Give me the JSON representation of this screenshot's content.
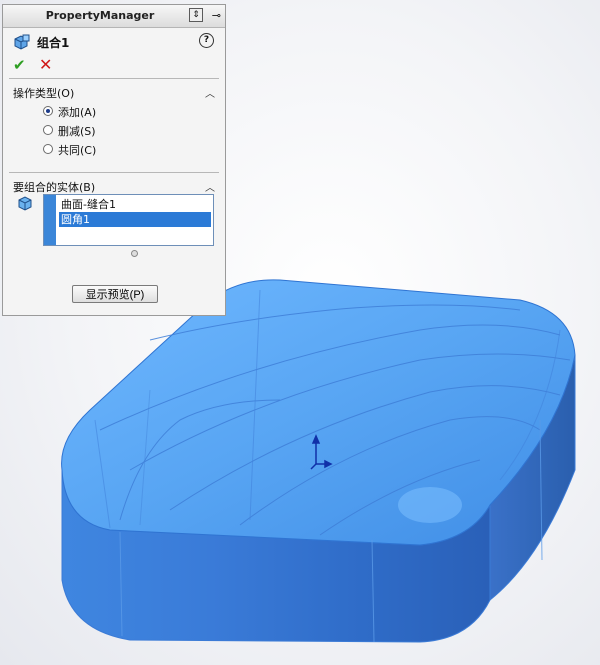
{
  "panel": {
    "title": "PropertyManager",
    "feature_name": "组合1",
    "help": "?"
  },
  "operation_type": {
    "title": "操作类型(O)",
    "options": [
      {
        "label": "添加(A)",
        "selected": true
      },
      {
        "label": "删减(S)",
        "selected": false
      },
      {
        "label": "共同(C)",
        "selected": false
      }
    ]
  },
  "bodies": {
    "title": "要组合的实体(B)",
    "items": [
      {
        "label": "曲面-缝合1",
        "selected": false
      },
      {
        "label": "圆角1",
        "selected": true
      }
    ]
  },
  "preview_button": "显示预览(P)",
  "colors": {
    "model_top": "#56a6f2",
    "model_side": "#2f6fd0",
    "selection": "#2b7ad6",
    "ok": "#2e9e22",
    "cancel": "#d01818"
  }
}
